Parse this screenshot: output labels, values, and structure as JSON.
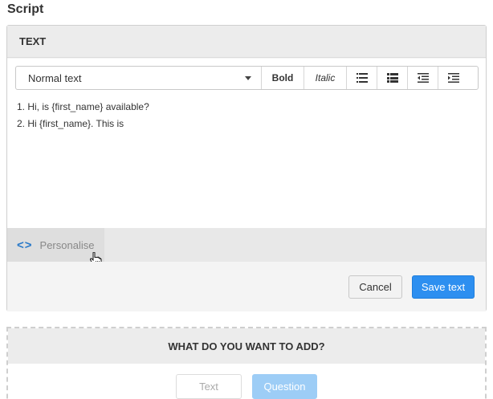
{
  "section": {
    "title": "Script"
  },
  "panel": {
    "header": "TEXT"
  },
  "toolbar": {
    "format_select": "Normal text",
    "bold_label": "Bold",
    "italic_label": "Italic",
    "icons": [
      "list-icon",
      "list-bold-icon",
      "outdent-icon",
      "indent-icon"
    ]
  },
  "editor": {
    "lines": [
      "1. Hi, is {first_name} available?",
      "2. Hi {first_name}. This is"
    ]
  },
  "personalise": {
    "label": "Personalise",
    "icon": "code-brackets-icon"
  },
  "footer": {
    "cancel_label": "Cancel",
    "save_label": "Save text",
    "save_color": "#2d8ff0"
  },
  "add": {
    "header": "WHAT DO YOU WANT TO ADD?",
    "text_label": "Text",
    "question_label": "Question"
  }
}
